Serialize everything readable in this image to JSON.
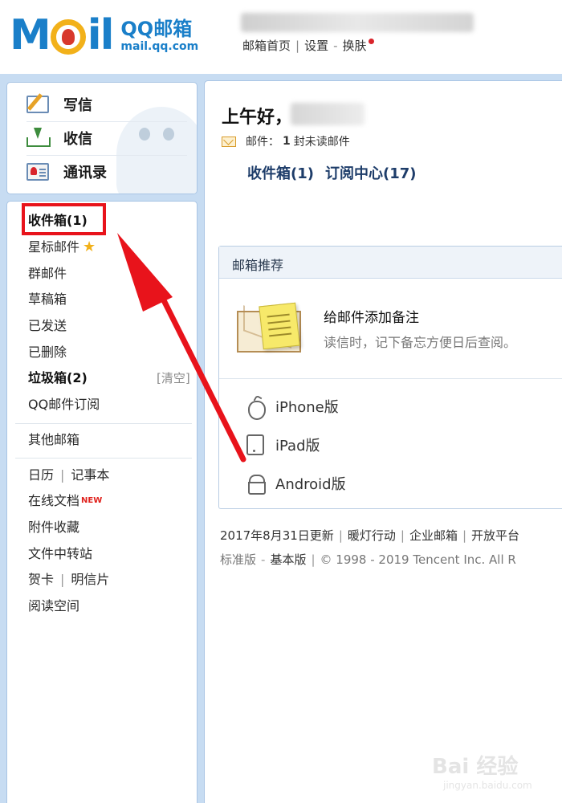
{
  "header": {
    "logo_text": "MOil",
    "logo_cn": "QQ邮箱",
    "logo_url": "mail.qq.com",
    "links": [
      "邮箱首页",
      "设置",
      "换肤"
    ]
  },
  "compose": {
    "write": "写信",
    "receive": "收信",
    "contacts": "通讯录"
  },
  "nav": {
    "inbox": "收件箱(1)",
    "starred": "星标邮件",
    "group": "群邮件",
    "drafts": "草稿箱",
    "sent": "已发送",
    "deleted": "已删除",
    "spam": "垃圾箱(2)",
    "spam_clear": "[清空]",
    "subscriptions": "QQ邮件订阅",
    "other_mailboxes": "其他邮箱",
    "calendar": "日历",
    "notepad": "记事本",
    "docs": "在线文档",
    "docs_badge": "NEW",
    "attachments": "附件收藏",
    "transfer": "文件中转站",
    "cards": "贺卡",
    "postcards": "明信片",
    "reading": "阅读空间"
  },
  "main": {
    "greeting": "上午好，",
    "unread_prefix": "邮件：",
    "unread_count": "1",
    "unread_suffix": "封未读邮件",
    "inbox_link": "收件箱(1)",
    "subscription_link": "订阅中心(17)"
  },
  "recommend": {
    "title": "邮箱推荐",
    "item_title": "给邮件添加备注",
    "item_desc": "读信时，记下备忘方便日后查阅。",
    "apps": [
      "iPhone版",
      "iPad版",
      "Android版"
    ]
  },
  "footer": {
    "line1": [
      "2017年8月31日更新",
      "暖灯行动",
      "企业邮箱",
      "开放平台"
    ],
    "line2_standard": "标准版",
    "line2_basic": "基本版",
    "line2_copyright": "© 1998 - 2019 Tencent Inc. All R"
  },
  "watermark": {
    "text": "Bai 经验",
    "url": "jingyan.baidu.com"
  },
  "colors": {
    "brand_blue": "#1a7fc9",
    "frame_blue": "#c7dcf2",
    "annotation_red": "#e8131b"
  }
}
